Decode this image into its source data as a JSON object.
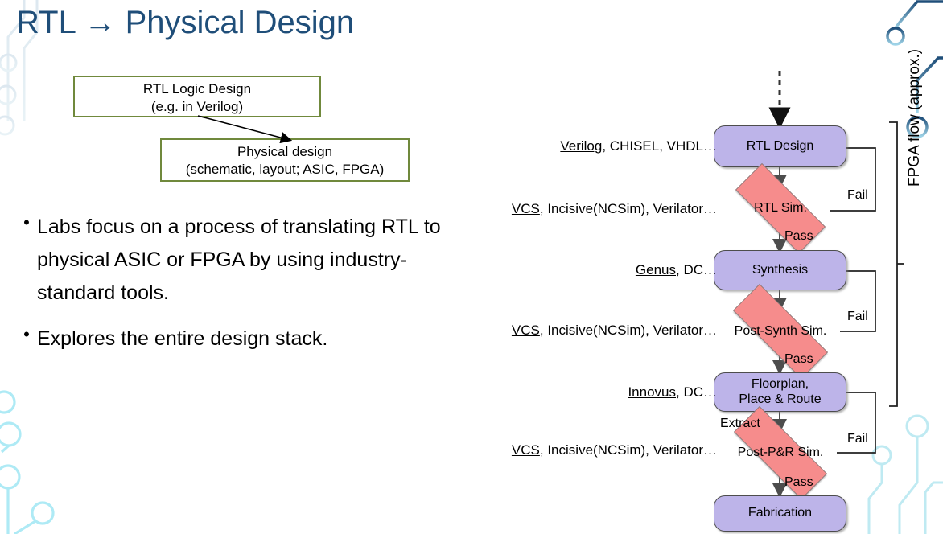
{
  "slide": {
    "title": "RTL → Physical Design",
    "title_color": "#1F4E79"
  },
  "green_boxes": [
    {
      "name": "rtl-logic-design",
      "line1": "RTL Logic Design",
      "line2": "(e.g. in Verilog)",
      "border_color": "#70893C"
    },
    {
      "name": "physical-design",
      "line1": "Physical design",
      "line2": "(schematic, layout; ASIC, FPGA)",
      "border_color": "#70893C"
    }
  ],
  "bullets": [
    {
      "marker": "•",
      "text": "Labs focus on a process of translating RTL to physical ASIC or FPGA by using industry-standard tools."
    },
    {
      "marker": "•",
      "text": "Explores the entire design stack."
    }
  ],
  "flow": {
    "process_color": "#BDB4E9",
    "decision_color": "#F68C8C",
    "nodes": [
      {
        "id": "rtl-design",
        "type": "process",
        "label": "RTL Design"
      },
      {
        "id": "rtl-sim",
        "type": "decision",
        "label": "RTL Sim."
      },
      {
        "id": "synthesis",
        "type": "process",
        "label": "Synthesis"
      },
      {
        "id": "post-synth-sim",
        "type": "decision",
        "label": "Post-Synth Sim."
      },
      {
        "id": "floorplan",
        "type": "process",
        "label_line1": "Floorplan,",
        "label_line2": "Place & Route"
      },
      {
        "id": "post-pnr-sim",
        "type": "decision",
        "label": "Post-P&R Sim."
      },
      {
        "id": "fabrication",
        "type": "process",
        "label": "Fabrication"
      }
    ],
    "tool_labels": [
      {
        "id": "tools-rtl-design",
        "underlined": "Verilog",
        "rest": ", CHISEL, VHDL…"
      },
      {
        "id": "tools-rtl-sim",
        "underlined": "VCS",
        "rest": ", Incisive(NCSim), Verilator…"
      },
      {
        "id": "tools-synthesis",
        "underlined": "Genus",
        "rest": ", DC…"
      },
      {
        "id": "tools-post-synth-sim",
        "underlined": "VCS",
        "rest": ", Incisive(NCSim), Verilator…"
      },
      {
        "id": "tools-floorplan",
        "underlined": "Innovus",
        "rest": ", DC…"
      },
      {
        "id": "tools-post-pnr-sim",
        "underlined": "VCS",
        "rest": ", Incisive(NCSim), Verilator…"
      }
    ],
    "edge_labels": {
      "fail_1": "Fail",
      "pass_1": "Pass",
      "fail_2": "Fail",
      "pass_2": "Pass",
      "extract": "Extract",
      "fail_3": "Fail",
      "pass_3": "Pass"
    },
    "bracket_label": "FPGA flow (approx.)"
  }
}
